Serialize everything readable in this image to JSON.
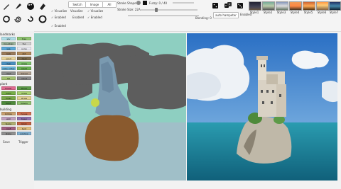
{
  "toolbar": {
    "row1": {
      "switch": "Switch",
      "image": "Image",
      "all": "All"
    },
    "row2": {
      "visualize1": "Visualize",
      "visualize2": "Visualize",
      "visualize3": "Visualize"
    },
    "row3": {
      "enabled1": "Enabled",
      "enabled2": "Enabled",
      "enabled3": "Enabled"
    },
    "enabled4": "Enabled",
    "stroke_shape": "Stroke Shape:",
    "fuzzy": "Fuzzy: 0 / 40",
    "stroke_size": "Stroke Size: 22A",
    "blending": "Blending: 0",
    "auto_hamper": "auto hampeter",
    "enabled_right": "Enabled"
  },
  "styles": [
    "Style1",
    "Style2",
    "Style3",
    "Style4",
    "Style5",
    "Style6",
    "Style7"
  ],
  "sidebar": {
    "landmarks_title": "landmarks",
    "landmarks": [
      [
        "sky",
        "tree"
      ],
      [
        "mountain",
        "fog"
      ],
      [
        "sea",
        "snow"
      ],
      [
        "rock",
        "dirt"
      ],
      [
        "sand",
        "mud"
      ],
      [
        "river",
        "grass"
      ],
      [
        "water-other",
        "plant"
      ],
      [
        "road",
        "gravel"
      ],
      [
        "hill",
        "cloud"
      ]
    ],
    "plant_title": "plant",
    "plant": [
      [
        "flower",
        "shrub"
      ],
      [
        "palm",
        "grass"
      ],
      [
        "moss",
        "straw"
      ],
      [
        "bush",
        "leaves"
      ]
    ],
    "building_title": "building",
    "building": [
      [
        "bridge",
        "house"
      ],
      [
        "wall",
        "tower"
      ],
      [
        "fence",
        "brick"
      ],
      [
        "roof",
        "tent"
      ],
      [
        "stone",
        "window"
      ]
    ],
    "bottom": {
      "save": "Save",
      "trigger": "Trigger"
    }
  },
  "colors": {
    "canvas_bg": "#8ecfc1",
    "cloud": "#5d5d5d",
    "water_sky": "#a0bfc8",
    "rock_brown": "#8a5a2e"
  }
}
